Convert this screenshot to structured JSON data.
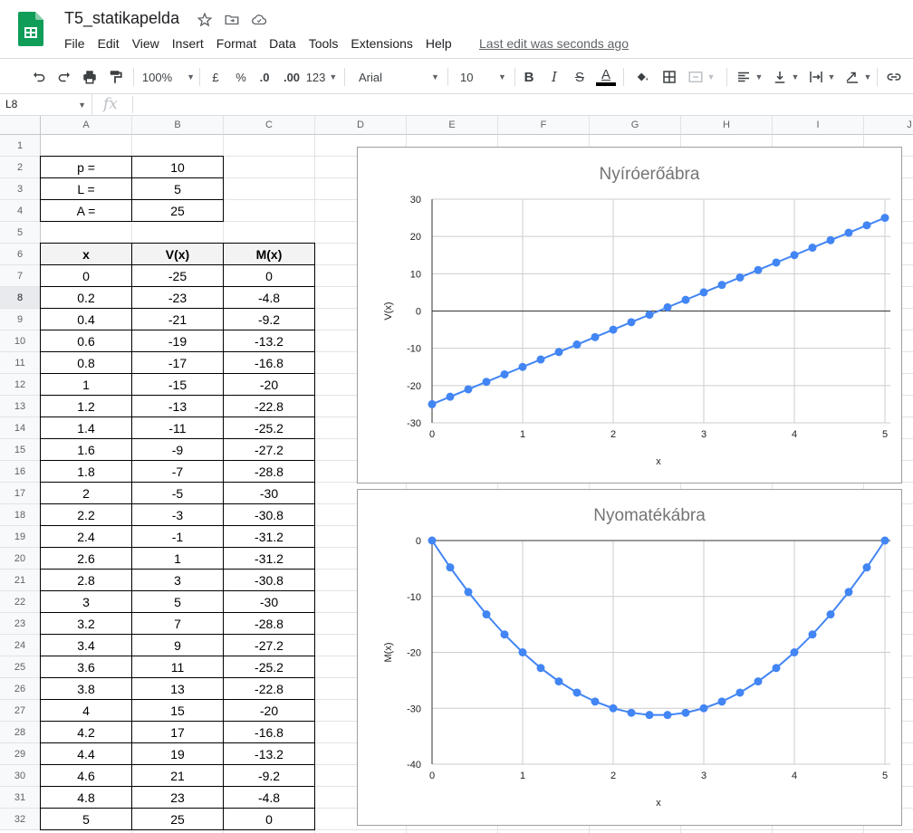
{
  "app": {
    "title": "T5_statikapelda",
    "last_edit": "Last edit was seconds ago",
    "menu": [
      "File",
      "Edit",
      "View",
      "Insert",
      "Format",
      "Data",
      "Tools",
      "Extensions",
      "Help"
    ]
  },
  "toolbar": {
    "zoom": "100%",
    "currency": "£",
    "percent": "%",
    "dec_decrease": ".0",
    "dec_increase": ".00",
    "format_more": "123",
    "font": "Arial",
    "font_size": "10",
    "icons": [
      "undo-icon",
      "redo-icon",
      "print-icon",
      "paint-format-icon",
      "bold-icon",
      "italic-icon",
      "strikethrough-icon",
      "text-color-icon",
      "fill-color-icon",
      "borders-icon",
      "merge-cells-icon",
      "align-left-icon",
      "valign-bottom-icon",
      "text-wrap-icon",
      "text-rotate-icon",
      "insert-link-icon"
    ],
    "text_color_bar": "#000000"
  },
  "formula_bar": {
    "cell_ref": "L8",
    "fx": "fx",
    "value": ""
  },
  "sheet": {
    "columns": [
      "A",
      "B",
      "C",
      "D",
      "E",
      "F",
      "G",
      "H",
      "I",
      "J"
    ],
    "rows": [
      "1",
      "2",
      "3",
      "4",
      "5",
      "6",
      "7",
      "8",
      "9",
      "10",
      "11",
      "12",
      "13",
      "14",
      "15",
      "16",
      "17",
      "18",
      "19",
      "20",
      "21",
      "22",
      "23",
      "24",
      "25",
      "26",
      "27",
      "28",
      "29",
      "30",
      "31",
      "32"
    ],
    "selected_row": "8",
    "params": [
      {
        "label": "p =",
        "value": "10"
      },
      {
        "label": "L =",
        "value": "5"
      },
      {
        "label": "A =",
        "value": "25"
      }
    ],
    "table_headers": [
      "x",
      "V(x)",
      "M(x)"
    ],
    "table_rows": [
      [
        "0",
        "-25",
        "0"
      ],
      [
        "0.2",
        "-23",
        "-4.8"
      ],
      [
        "0.4",
        "-21",
        "-9.2"
      ],
      [
        "0.6",
        "-19",
        "-13.2"
      ],
      [
        "0.8",
        "-17",
        "-16.8"
      ],
      [
        "1",
        "-15",
        "-20"
      ],
      [
        "1.2",
        "-13",
        "-22.8"
      ],
      [
        "1.4",
        "-11",
        "-25.2"
      ],
      [
        "1.6",
        "-9",
        "-27.2"
      ],
      [
        "1.8",
        "-7",
        "-28.8"
      ],
      [
        "2",
        "-5",
        "-30"
      ],
      [
        "2.2",
        "-3",
        "-30.8"
      ],
      [
        "2.4",
        "-1",
        "-31.2"
      ],
      [
        "2.6",
        "1",
        "-31.2"
      ],
      [
        "2.8",
        "3",
        "-30.8"
      ],
      [
        "3",
        "5",
        "-30"
      ],
      [
        "3.2",
        "7",
        "-28.8"
      ],
      [
        "3.4",
        "9",
        "-27.2"
      ],
      [
        "3.6",
        "11",
        "-25.2"
      ],
      [
        "3.8",
        "13",
        "-22.8"
      ],
      [
        "4",
        "15",
        "-20"
      ],
      [
        "4.2",
        "17",
        "-16.8"
      ],
      [
        "4.4",
        "19",
        "-13.2"
      ],
      [
        "4.6",
        "21",
        "-9.2"
      ],
      [
        "4.8",
        "23",
        "-4.8"
      ],
      [
        "5",
        "25",
        "0"
      ]
    ]
  },
  "chart_data": [
    {
      "type": "line",
      "title": "Nyíróerőábra",
      "xlabel": "x",
      "ylabel": "V(x)",
      "xlim": [
        0,
        5
      ],
      "ylim": [
        -30,
        30
      ],
      "xticks": [
        0,
        1,
        2,
        3,
        4,
        5
      ],
      "yticks": [
        -30,
        -20,
        -10,
        0,
        10,
        20,
        30
      ],
      "grid": true,
      "color": "#4285f4",
      "x": [
        0,
        0.2,
        0.4,
        0.6,
        0.8,
        1,
        1.2,
        1.4,
        1.6,
        1.8,
        2,
        2.2,
        2.4,
        2.6,
        2.8,
        3,
        3.2,
        3.4,
        3.6,
        3.8,
        4,
        4.2,
        4.4,
        4.6,
        4.8,
        5
      ],
      "series": [
        {
          "values": [
            -25,
            -23,
            -21,
            -19,
            -17,
            -15,
            -13,
            -11,
            -9,
            -7,
            -5,
            -3,
            -1,
            1,
            3,
            5,
            7,
            9,
            11,
            13,
            15,
            17,
            19,
            21,
            23,
            25
          ]
        }
      ]
    },
    {
      "type": "line",
      "title": "Nyomatékábra",
      "xlabel": "x",
      "ylabel": "M(x)",
      "xlim": [
        0,
        5
      ],
      "ylim": [
        -40,
        0
      ],
      "xticks": [
        0,
        1,
        2,
        3,
        4,
        5
      ],
      "yticks": [
        -40,
        -30,
        -20,
        -10,
        0
      ],
      "grid": true,
      "color": "#4285f4",
      "x": [
        0,
        0.2,
        0.4,
        0.6,
        0.8,
        1,
        1.2,
        1.4,
        1.6,
        1.8,
        2,
        2.2,
        2.4,
        2.6,
        2.8,
        3,
        3.2,
        3.4,
        3.6,
        3.8,
        4,
        4.2,
        4.4,
        4.6,
        4.8,
        5
      ],
      "series": [
        {
          "values": [
            0,
            -4.8,
            -9.2,
            -13.2,
            -16.8,
            -20,
            -22.8,
            -25.2,
            -27.2,
            -28.8,
            -30,
            -30.8,
            -31.2,
            -31.2,
            -30.8,
            -30,
            -28.8,
            -27.2,
            -25.2,
            -22.8,
            -20,
            -16.8,
            -13.2,
            -9.2,
            -4.8,
            0
          ]
        }
      ]
    }
  ]
}
